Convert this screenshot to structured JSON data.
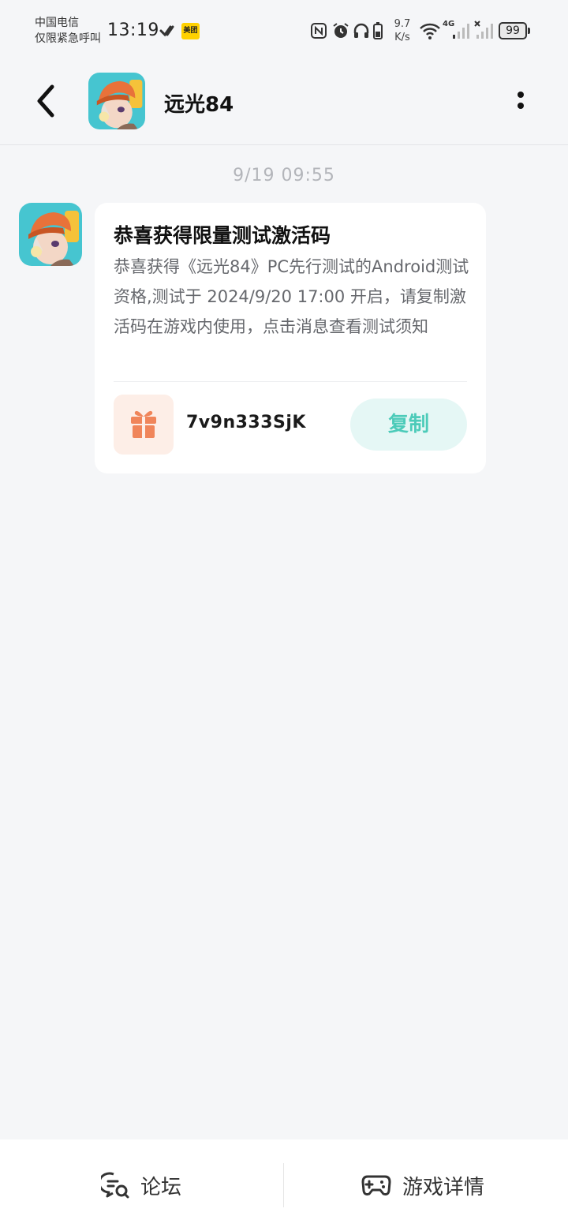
{
  "status_bar": {
    "carrier_line1": "中国电信",
    "carrier_line2": "仅限紧急呼叫",
    "time": "13:19",
    "app_badge": "美团",
    "net_speed_value": "9.7",
    "net_speed_unit": "K/s",
    "network_type": "4G",
    "battery": "99"
  },
  "header": {
    "title": "远光84",
    "back_icon": "chevron-left-icon",
    "more_icon": "more-vertical-icon"
  },
  "chat": {
    "timestamp": "9/19  09:55",
    "message": {
      "title": "恭喜获得限量测试激活码",
      "body": "恭喜获得《远光84》PC先行测试的Android测试资格,测试于 2024/9/20 17:00 开启，请复制激活码在游戏内使用，点击消息查看测试须知",
      "code": "7v9n333SjK",
      "copy_label": "复制",
      "gift_icon": "gift-icon"
    }
  },
  "bottom_nav": {
    "forum_label": "论坛",
    "game_details_label": "游戏详情"
  },
  "colors": {
    "background": "#f5f6f8",
    "accent_teal": "#4ccbb9",
    "gift_orange": "#f0855a"
  }
}
